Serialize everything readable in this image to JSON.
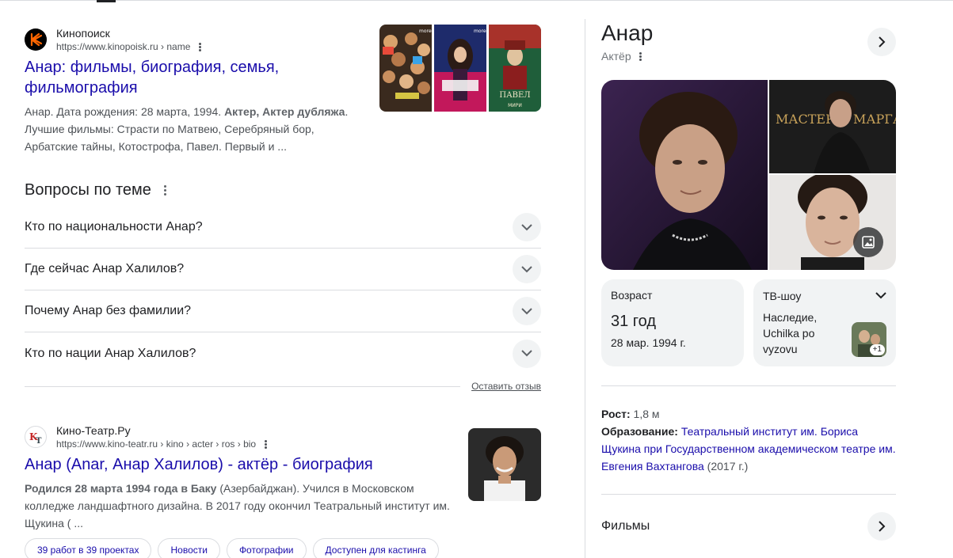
{
  "results": [
    {
      "site_name": "Кинопоиск",
      "url": "https://www.kinopoisk.ru › name",
      "title_line1": "Анар: фильмы, биография, семья,",
      "title_line2": "фильмография",
      "snippet_line1_a": "Анар. Дата рождения: 28 марта, 1994. ",
      "snippet_line1_b": "Актер, Актер дубляжа",
      "snippet_line1_c": ".",
      "snippet_line2": "Лучшие фильмы: Страсти по Матвею, Серебряный бор,",
      "snippet_line3": "Арбатские тайны, Котострофа, Павел. Первый и ..."
    },
    {
      "site_name": "Кино-Театр.Ру",
      "url": "https://www.kino-teatr.ru › kino › acter › ros › bio",
      "title": "Анар (Anar, Анар Халилов) - актёр - биография",
      "snippet_bold": "Родился 28 марта 1994 года в Баку",
      "snippet_line1_rest": " (Азербайджан). Учился в Московском",
      "snippet_line2": "колледже ландшафтного дизайна. В 2017 году окончил Театральный институт им.",
      "snippet_line3": "Щукина ( ...",
      "chips": [
        "39 работ в 39 проектах",
        "Новости",
        "Фотографии",
        "Доступен для кастинга"
      ]
    }
  ],
  "thumb_labels": [
    "moreo",
    "moreo",
    "ПАВЕЛ",
    "МИРИ"
  ],
  "paa": {
    "title": "Вопросы по теме",
    "questions": [
      "Кто по национальности Анар?",
      "Где сейчас Анар Халилов?",
      "Почему Анар без фамилии?",
      "Кто по нации Анар Халилов?"
    ],
    "feedback": "Оставить отзыв"
  },
  "knowledge_panel": {
    "name": "Анар",
    "subtitle": "Актёр",
    "image_caption": "МАСТЕР И МАРГАРИТА",
    "age_card": {
      "label": "Возраст",
      "value": "31 год",
      "sub": "28 мар. 1994 г."
    },
    "tv_card": {
      "label": "ТВ-шоу",
      "line1": "Наследие,",
      "line2": "Uchilka po",
      "line3": "vyzovu",
      "badge": "+1"
    },
    "facts": {
      "height_label": "Рост:",
      "height_value": " 1,8 м",
      "edu_label": "Образование:",
      "edu_link_line1": "Театральный институт им. Бориса",
      "edu_link_line2": "Щукина при Государственном академическом театре им.",
      "edu_link_line3": "Евгения Вахтангова",
      "edu_year": " (2017 г.)"
    },
    "films_title": "Фильмы"
  },
  "colors": {
    "link": "#1a0dab",
    "text": "#202124",
    "muted": "#4d5156",
    "divider": "#dadce0",
    "chip_bg": "#f1f3f4",
    "kinopoisk_orange": "#ff6600"
  }
}
